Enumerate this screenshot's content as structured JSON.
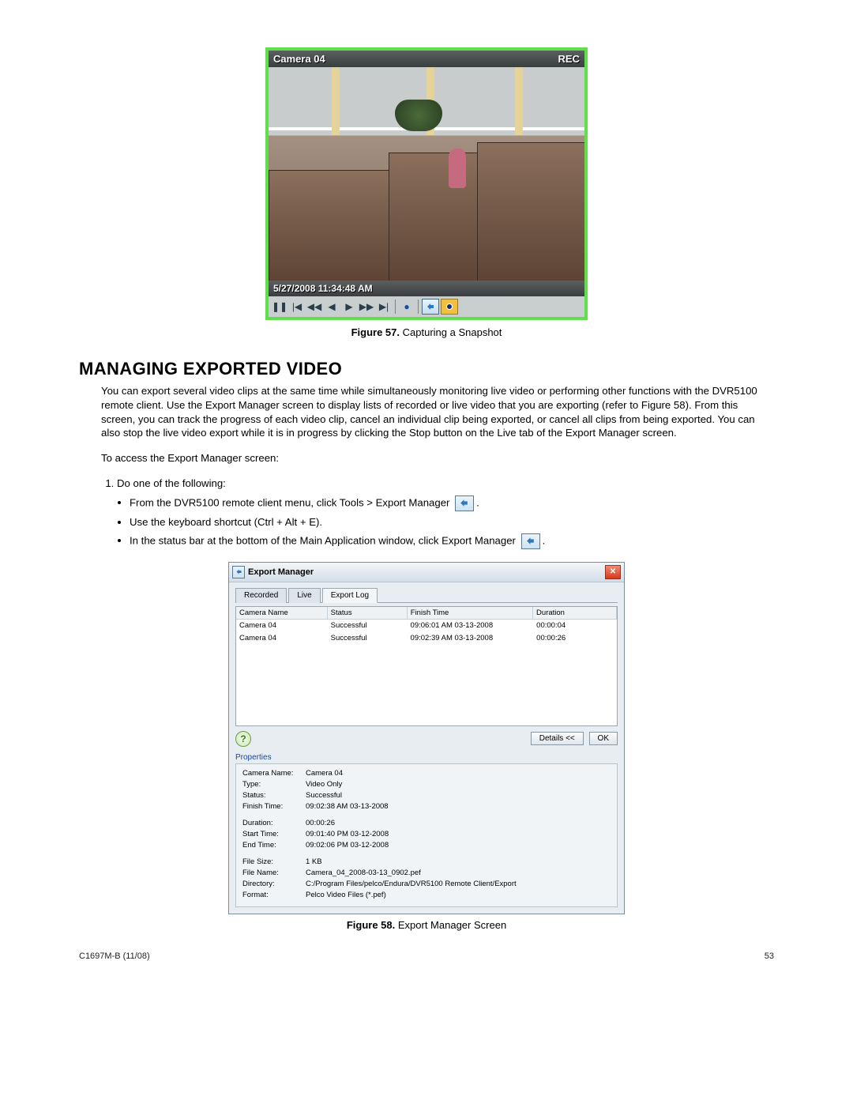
{
  "figure57": {
    "camera_label": "Camera 04",
    "rec_label": "REC",
    "timestamp": "5/27/2008 11:34:48 AM",
    "caption_prefix": "Figure 57.",
    "caption_text": "Capturing a Snapshot"
  },
  "section_heading": "MANAGING EXPORTED VIDEO",
  "para1": "You can export several video clips at the same time while simultaneously monitoring live video or performing other functions with the DVR5100 remote client. Use the Export Manager screen to display lists of recorded or live video that you are exporting (refer to Figure 58). From this screen, you can track the progress of each video clip, cancel an individual clip being exported, or cancel all clips from being exported. You can also stop the live video export while it is in progress by clicking the Stop button on the Live tab of the Export Manager screen.",
  "para2": "To access the Export Manager screen:",
  "step1": "Do one of the following:",
  "bullet1a": "From the DVR5100 remote client menu, click Tools > Export Manager",
  "bullet1b": ".",
  "bullet2": "Use the keyboard shortcut (Ctrl + Alt + E).",
  "bullet3a": "In the status bar at the bottom of the Main Application window, click Export Manager",
  "bullet3b": ".",
  "dialog": {
    "title": "Export Manager",
    "tab_recorded": "Recorded",
    "tab_live": "Live",
    "tab_log": "Export Log",
    "col_camera": "Camera Name",
    "col_status": "Status",
    "col_finish": "Finish Time",
    "col_duration": "Duration",
    "rows": [
      {
        "camera": "Camera 04",
        "status": "Successful",
        "finish": "09:06:01 AM 03-13-2008",
        "duration": "00:00:04"
      },
      {
        "camera": "Camera 04",
        "status": "Successful",
        "finish": "09:02:39 AM 03-13-2008",
        "duration": "00:00:26"
      }
    ],
    "btn_details": "Details <<",
    "btn_ok": "OK",
    "props_heading": "Properties",
    "props": {
      "camera_name_l": "Camera Name:",
      "camera_name_v": "Camera 04",
      "type_l": "Type:",
      "type_v": "Video Only",
      "status_l": "Status:",
      "status_v": "Successful",
      "finish_l": "Finish Time:",
      "finish_v": "09:02:38 AM 03-13-2008",
      "duration_l": "Duration:",
      "duration_v": "00:00:26",
      "start_l": "Start Time:",
      "start_v": "09:01:40 PM 03-12-2008",
      "end_l": "End Time:",
      "end_v": "09:02:06 PM 03-12-2008",
      "size_l": "File Size:",
      "size_v": "1 KB",
      "fname_l": "File Name:",
      "fname_v": "Camera_04_2008-03-13_0902.pef",
      "dir_l": "Directory:",
      "dir_v": "C:/Program Files/pelco/Endura/DVR5100 Remote Client/Export",
      "fmt_l": "Format:",
      "fmt_v": "Pelco Video Files (*.pef)"
    }
  },
  "figure58": {
    "caption_prefix": "Figure 58.",
    "caption_text": "Export Manager Screen"
  },
  "footer_left": "C1697M-B (11/08)",
  "footer_right": "53"
}
